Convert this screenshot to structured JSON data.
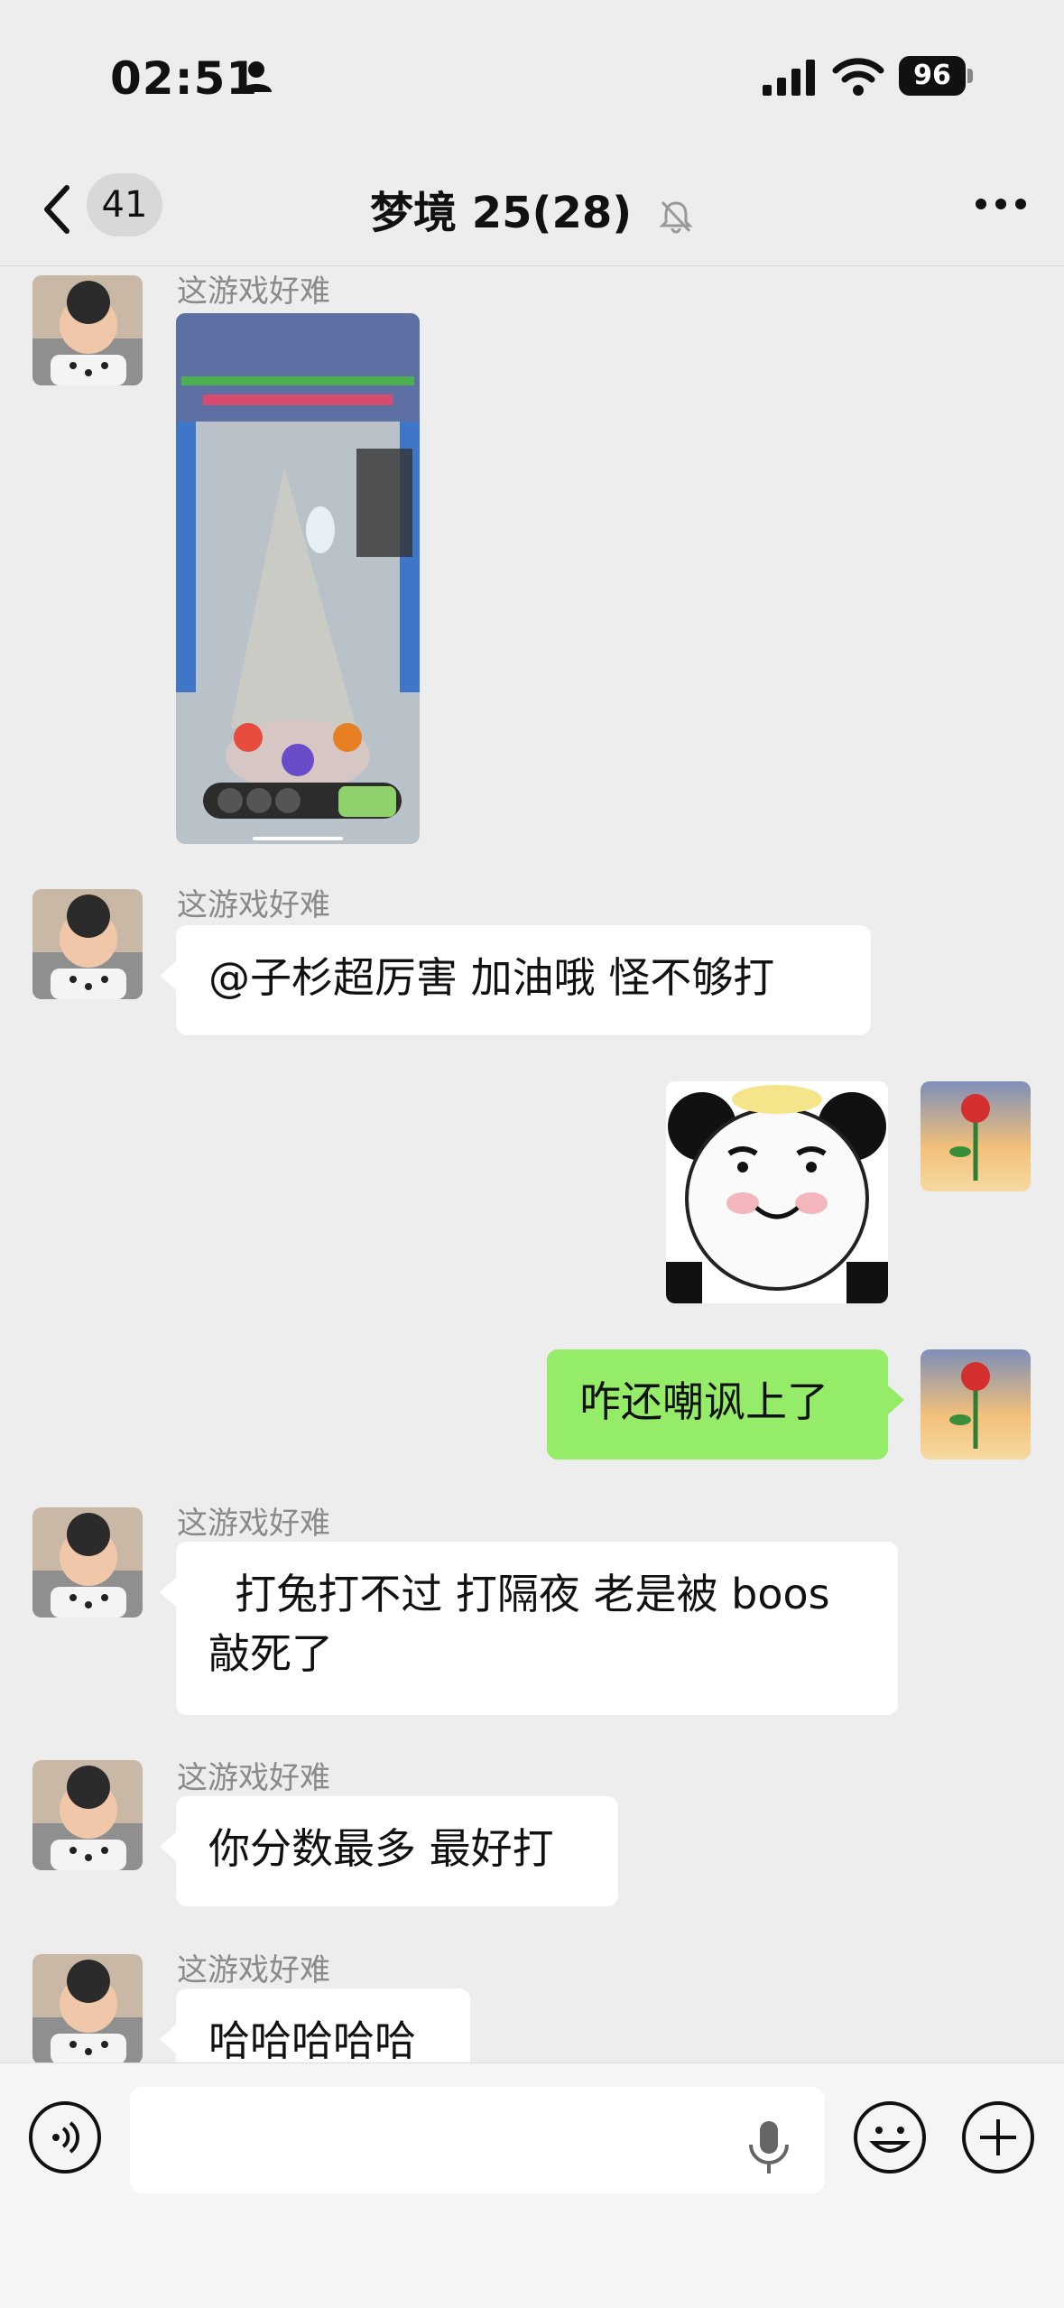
{
  "status_bar": {
    "time": "02:51",
    "battery": "96"
  },
  "header": {
    "back_count": "41",
    "title": "梦境 25(28)"
  },
  "messages": [
    {
      "side": "left",
      "sender": "这游戏好难",
      "type": "image",
      "image_desc": "game-screenshot"
    },
    {
      "side": "left",
      "sender": "这游戏好难",
      "type": "text",
      "text": "@子杉超厉害  加油哦 怪不够打"
    },
    {
      "side": "right",
      "type": "sticker",
      "image_desc": "panda-face-sticker"
    },
    {
      "side": "right",
      "type": "text",
      "text": "咋还嘲讽上了"
    },
    {
      "side": "left",
      "sender": "这游戏好难",
      "type": "text",
      "text": "  打兔打不过 打隔夜 老是被 boos 敲死了"
    },
    {
      "side": "left",
      "sender": "这游戏好难",
      "type": "text",
      "text": "你分数最多 最好打"
    },
    {
      "side": "left",
      "sender": "这游戏好难",
      "type": "text",
      "text": "哈哈哈哈哈"
    }
  ],
  "input_bar": {
    "input_value": "",
    "icons": [
      "voice-icon",
      "mic-icon",
      "emoji-icon",
      "plus-icon"
    ]
  },
  "colors": {
    "background": "#ededed",
    "bubble_other": "#ffffff",
    "bubble_self": "#95ec69",
    "input_bar": "#f5f5f5"
  }
}
